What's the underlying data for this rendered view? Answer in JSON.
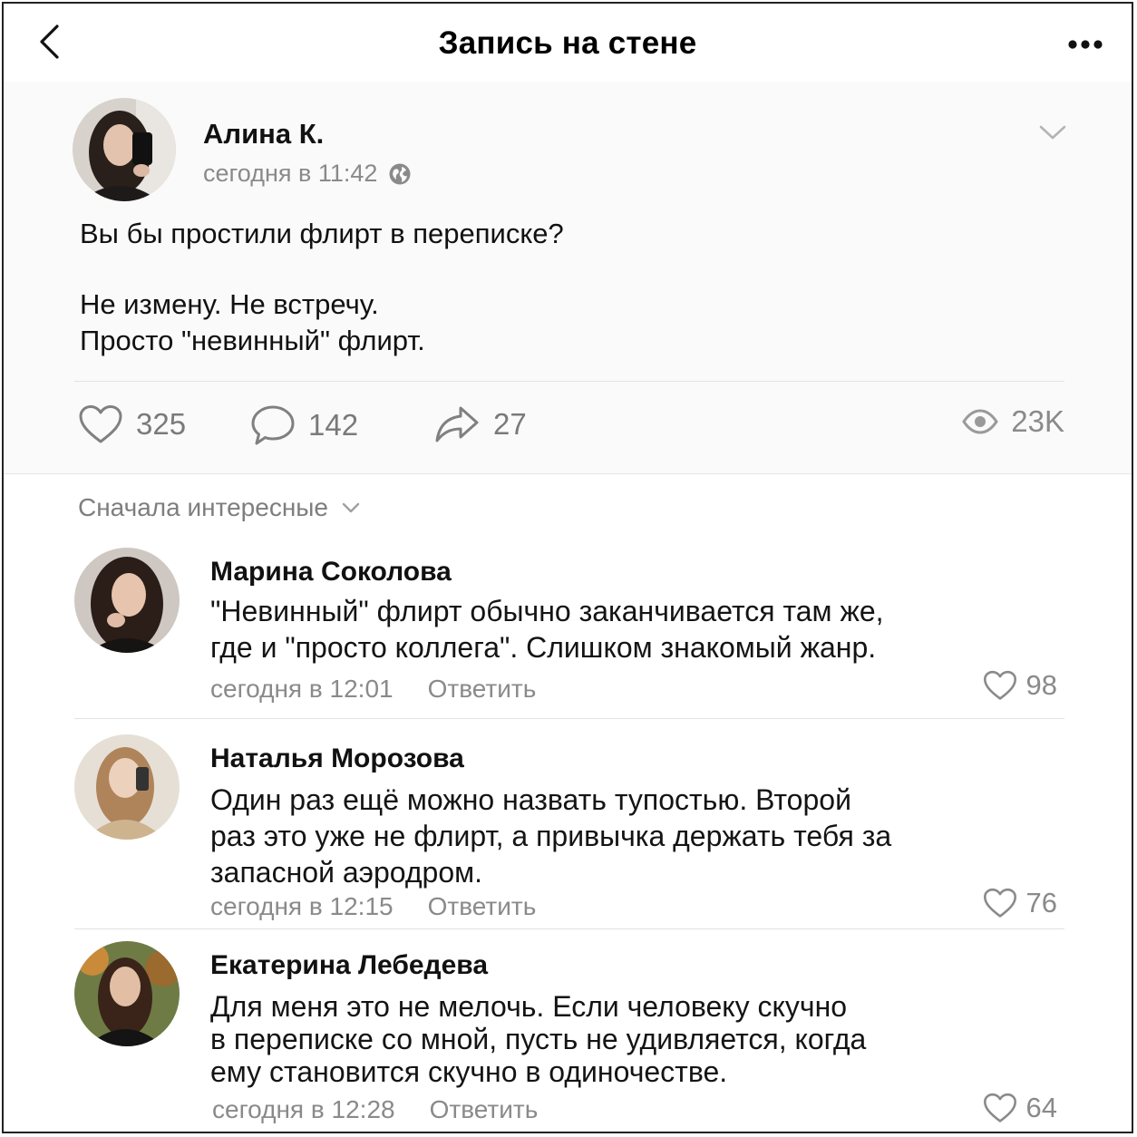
{
  "header": {
    "title": "Запись на стене",
    "back_icon": "chevron-left-icon",
    "more_icon": "more-dots-icon"
  },
  "post": {
    "author": "Алина К.",
    "time": "сегодня в 11:42",
    "lines": [
      "Вы бы простили флирт в переписке?",
      "",
      "Не измену. Не встречу.",
      "Просто \"невинный\" флирт."
    ],
    "likes": "325",
    "comments": "142",
    "shares": "27",
    "views": "23K"
  },
  "comments_section": {
    "sort_label": "Сначала интересные",
    "reply_label": "Ответить",
    "items": [
      {
        "author": "Марина Соколова",
        "lines": [
          "\"Невинный\" флирт обычно заканчивается там же,",
          "где и \"просто коллега\". Слишком знакомый жанр."
        ],
        "time": "сегодня в 12:01",
        "likes": "98"
      },
      {
        "author": "Наталья Морозова",
        "lines": [
          "Один раз ещё можно назвать тупостью. Второй",
          "раз это уже не флирт, а привычка держать тебя за",
          "запасной аэродром."
        ],
        "time": "сегодня в 12:15",
        "likes": "76"
      },
      {
        "author": "Екатерина Лебедева",
        "lines": [
          "Для меня это не мелочь. Если человеку скучно",
          "в переписке со мной, пусть не удивляется, когда",
          "ему становится скучно в одиночестве."
        ],
        "time": "сегодня в 12:28",
        "likes": "64"
      }
    ]
  },
  "colors": {
    "muted": "#8a8a8a",
    "text": "#111111",
    "divider": "#e2e2e2"
  }
}
